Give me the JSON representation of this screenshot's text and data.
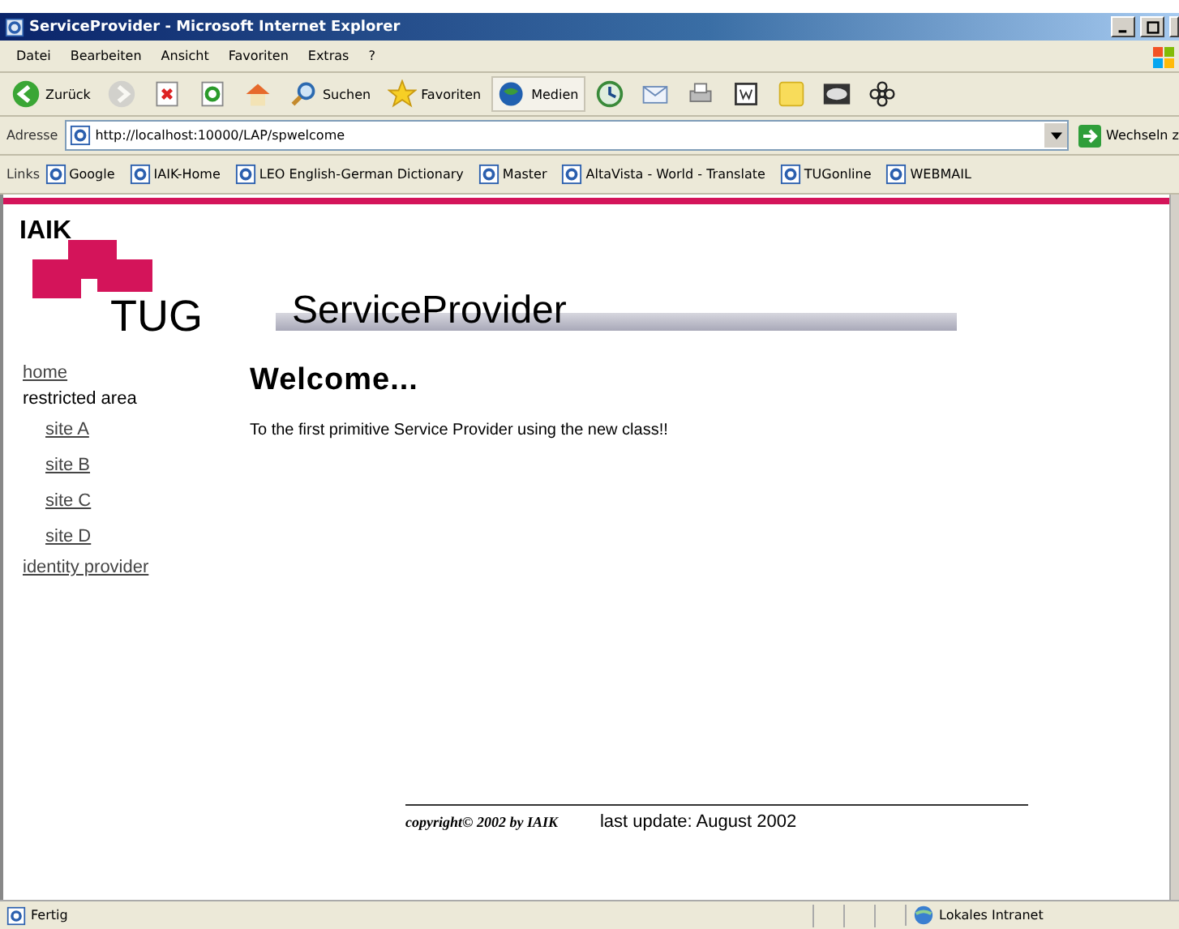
{
  "window": {
    "title": "ServiceProvider - Microsoft Internet Explorer"
  },
  "menu": [
    "Datei",
    "Bearbeiten",
    "Ansicht",
    "Favoriten",
    "Extras",
    "?"
  ],
  "toolbar": [
    {
      "kind": "back",
      "label": "Zurück",
      "disabled": false
    },
    {
      "kind": "forward",
      "disabled": true
    },
    {
      "kind": "stop"
    },
    {
      "kind": "refresh"
    },
    {
      "kind": "home"
    },
    {
      "kind": "search",
      "label": "Suchen"
    },
    {
      "kind": "favorites",
      "label": "Favoriten"
    },
    {
      "kind": "media",
      "label": "Medien",
      "selected": true
    },
    {
      "kind": "history"
    },
    {
      "kind": "mail"
    },
    {
      "kind": "print"
    },
    {
      "kind": "edit"
    },
    {
      "kind": "note"
    },
    {
      "kind": "spy"
    },
    {
      "kind": "flower"
    }
  ],
  "address": {
    "label": "Adresse",
    "value": "http://localhost:10000/LAP/spwelcome",
    "go": "Wechseln z"
  },
  "links": {
    "label": "Links",
    "items": [
      "Google",
      "IAIK-Home",
      "LEO English-German Dictionary",
      "Master",
      "AltaVista - World - Translate",
      "TUGonline",
      "WEBMAIL"
    ]
  },
  "page": {
    "logo_top": "IAIK",
    "logo_bottom": "TUG",
    "banner": "ServiceProvider",
    "nav": [
      {
        "kind": "link",
        "label": "home"
      },
      {
        "kind": "label",
        "label": "restricted area",
        "children": [
          {
            "kind": "link",
            "label": "site A"
          },
          {
            "kind": "link",
            "label": "site B"
          },
          {
            "kind": "link",
            "label": "site C"
          },
          {
            "kind": "link",
            "label": "site D"
          }
        ]
      },
      {
        "kind": "link",
        "label": "identity provider"
      }
    ],
    "heading": "Welcome...",
    "text": "To the first primitive Service Provider using the new class!!",
    "copyright": "copyright© 2002 by IAIK",
    "last_update": "last update: August 2002"
  },
  "status_bar": {
    "text": "Fertig",
    "zone": "Lokales Intranet"
  }
}
